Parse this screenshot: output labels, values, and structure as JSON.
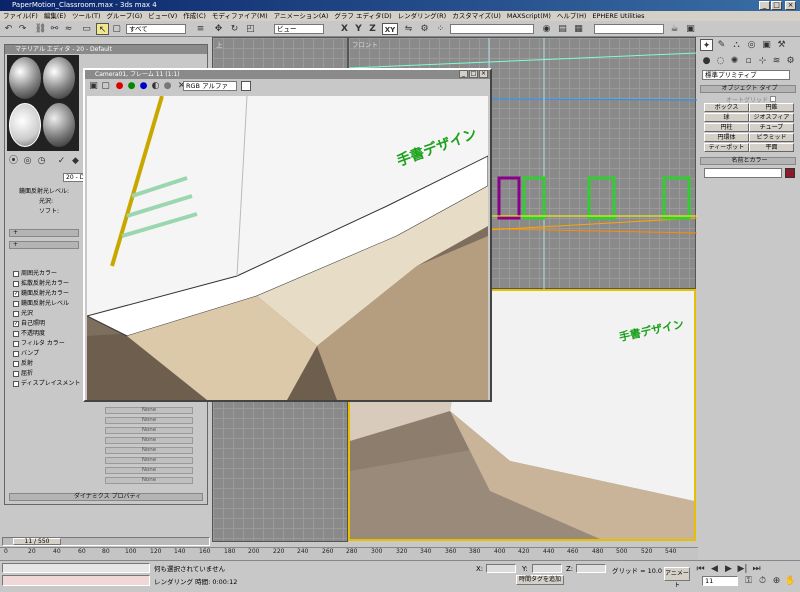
{
  "window": {
    "title": "PaperMotion_Classroom.max - 3ds max 4"
  },
  "menu": [
    "ファイル(F)",
    "編集(E)",
    "ツール(T)",
    "グループ(G)",
    "ビュー(V)",
    "作成(C)",
    "モディファイア(M)",
    "アニメーション(A)",
    "グラフ エディタ(D)",
    "レンダリング(R)",
    "カスタマイズ(U)",
    "MAXScript(M)",
    "ヘルプ(H)",
    "EPHERE Utilities"
  ],
  "toolbar": {
    "selection_filter": "すべて",
    "ref_coord": "ビュー",
    "axis": [
      "X",
      "Y",
      "Z",
      "XY"
    ]
  },
  "viewports": {
    "top_left_label": "上",
    "top_right_label": "フロント"
  },
  "material_editor": {
    "title": "マテリアル エディタ - 20 - Default",
    "slot_name": "20 - D",
    "params_top": [
      "鏡面反射光レベル:",
      "光沢:",
      "ソフト:"
    ],
    "rollouts": [
      "+",
      "+"
    ],
    "map_rows": [
      {
        "label": "周囲光カラー",
        "checked": false
      },
      {
        "label": "拡散反射光カラー",
        "checked": false
      },
      {
        "label": "鏡面反射光カラー",
        "checked": true
      },
      {
        "label": "鏡面反射光レベル",
        "checked": false
      },
      {
        "label": "光沢",
        "checked": false
      },
      {
        "label": "自己照明",
        "checked": true
      },
      {
        "label": "不透明度",
        "checked": false
      },
      {
        "label": "フィルタ カラー",
        "checked": false
      },
      {
        "label": "バンプ",
        "checked": false
      },
      {
        "label": "反射",
        "checked": false
      },
      {
        "label": "屈折",
        "checked": false
      },
      {
        "label": "ディスプレイスメント",
        "checked": false
      }
    ],
    "none_label": "None",
    "dynamics_rollout": "ダイナミクス プロパティ"
  },
  "render_window": {
    "title": "Camera01, フレーム 11 (1:1)",
    "channel": "RGB アルファ",
    "logo_text": "手書デザイン"
  },
  "command_panel": {
    "dropdown": "標準プリミティブ",
    "object_type_header": "オブジェクト タイプ",
    "autogrid": "オートグリッド",
    "buttons": [
      "ボックス",
      "円錐",
      "球",
      "ジオスフィア",
      "円柱",
      "チューブ",
      "円環体",
      "ピラミッド",
      "ティーポット",
      "平面"
    ],
    "name_color_header": "名前とカラー",
    "object_color": "#8b1a2a"
  },
  "timeline": {
    "frame_counter": "11 / 550",
    "ticks": [
      "0",
      "20",
      "40",
      "60",
      "80",
      "100",
      "120",
      "140",
      "160",
      "180",
      "200",
      "220",
      "240",
      "260",
      "280",
      "300",
      "320",
      "340",
      "360",
      "380",
      "400",
      "420",
      "440",
      "460",
      "480",
      "500",
      "520",
      "540"
    ]
  },
  "status": {
    "prompt": "何も選択されていません",
    "render_time": "レンダリング 時間: 0:00:12",
    "x_label": "X:",
    "y_label": "Y:",
    "z_label": "Z:",
    "grid": "グリッド = 10.0",
    "add_time_tag": "時間タグを追加",
    "animate": "アニメート",
    "frame": "11"
  }
}
